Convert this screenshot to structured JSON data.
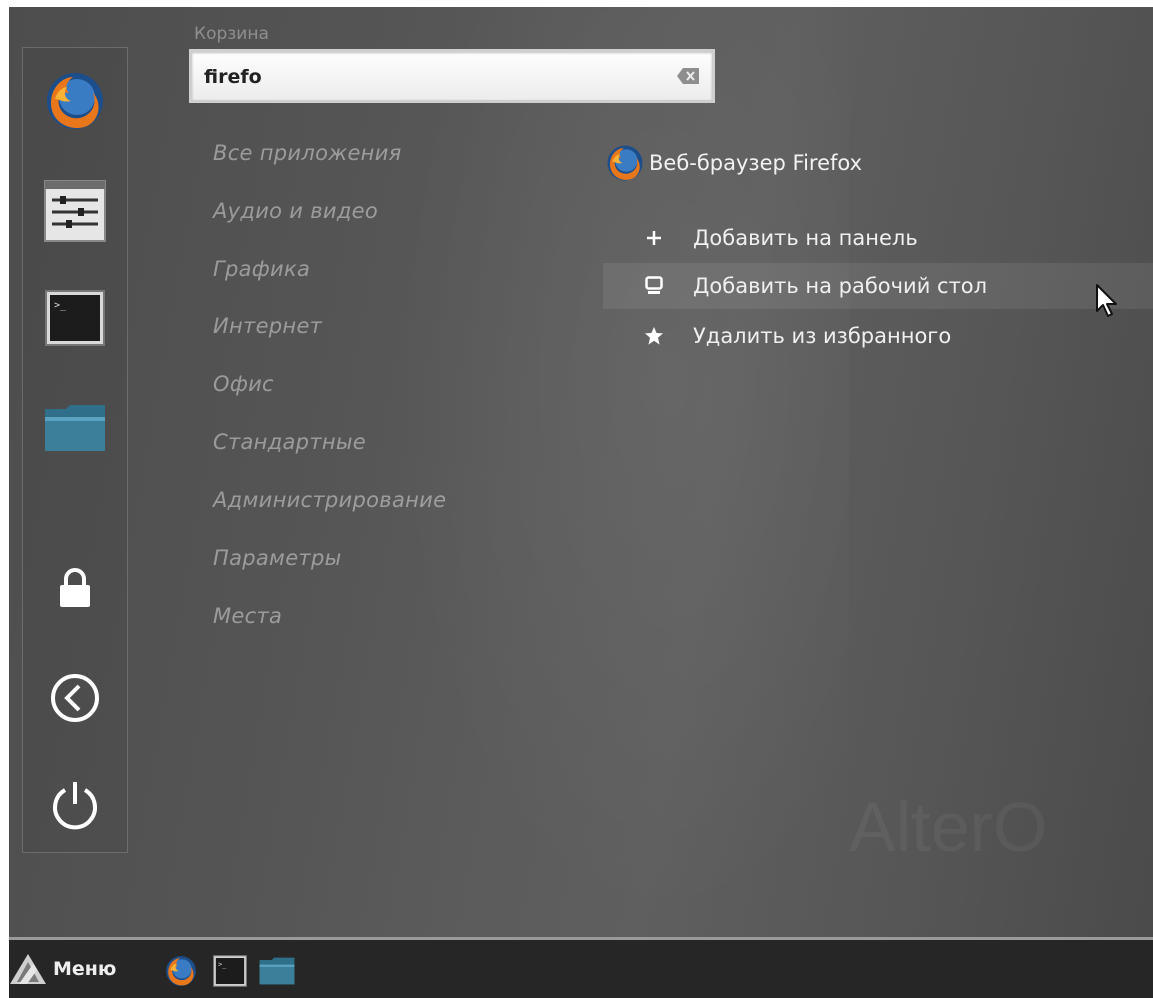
{
  "desktop": {
    "label": "Корзина",
    "watermark": "AlterO"
  },
  "sidebar": {
    "favorites": [
      {
        "icon": "firefox-icon",
        "name": "firefox"
      },
      {
        "icon": "settings-icon",
        "name": "settings"
      },
      {
        "icon": "terminal-icon",
        "name": "terminal"
      },
      {
        "icon": "folder-icon",
        "name": "files"
      }
    ],
    "system": [
      {
        "icon": "lock-icon",
        "name": "lock"
      },
      {
        "icon": "logout-icon",
        "name": "logout"
      },
      {
        "icon": "power-icon",
        "name": "power"
      }
    ]
  },
  "search": {
    "value": "firefo",
    "placeholder": ""
  },
  "categories": [
    "Все приложения",
    "Аудио и видео",
    "Графика",
    "Интернет",
    "Офис",
    "Стандартные",
    "Администрирование",
    "Параметры",
    "Места"
  ],
  "result": {
    "app_name": "Веб-браузер Firefox",
    "actions": [
      {
        "icon": "plus-icon",
        "label": "Добавить на панель"
      },
      {
        "icon": "desktop-icon",
        "label": "Добавить на рабочий стол"
      },
      {
        "icon": "star-icon",
        "label": "Удалить из избранного"
      }
    ]
  },
  "taskbar": {
    "menu_label": "Меню",
    "launchers": [
      "firefox-icon",
      "terminal-icon",
      "folder-icon"
    ]
  },
  "colors": {
    "firefox_orange": "#e8761b",
    "firefox_blue": "#1d4e8c",
    "folder_teal": "#3b7f9a"
  }
}
